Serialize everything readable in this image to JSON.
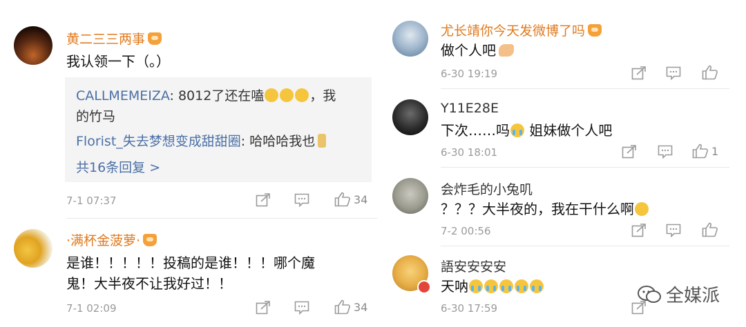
{
  "left": [
    {
      "username": "黄二三三两事",
      "text": "我认领一下（。）",
      "replies": [
        {
          "user": "CALLMEMEIZA",
          "line1": "8012了还在嗑",
          "line1_tail": "，我",
          "line2": "的竹马"
        },
        {
          "user": "Florist_失去梦想变成甜甜圈",
          "text": "哈哈哈我也"
        }
      ],
      "more_replies": "共16条回复 >",
      "time": "7-1 07:37",
      "likes": "34"
    },
    {
      "username": "·满杯金菠萝·",
      "text_line1": "是谁！！！！！投稿的是谁！！！哪个魔",
      "text_line2": "鬼！大半夜不让我好过！！",
      "time": "7-1 02:09",
      "likes": "34"
    }
  ],
  "right": [
    {
      "username": "尤长靖你今天发微博了吗",
      "text": "做个人吧",
      "time": "6-30 19:19",
      "likes": ""
    },
    {
      "username": "Y11E28E",
      "text_a": "下次……吗",
      "text_b": "姐妹做个人吧",
      "time": "6-30 18:01",
      "likes": "1"
    },
    {
      "username": "会炸毛的小兔叽",
      "text": "？？？大半夜的，我在干什么啊",
      "time": "7-2 00:56",
      "likes": ""
    },
    {
      "username": "語安安安安",
      "text": "天呐",
      "time": "6-30 17:59",
      "likes": ""
    }
  ],
  "watermark": "全媒派",
  "colors": {
    "vip_name": "#e07a1e",
    "link_blue": "#4a6fa6",
    "meta_gray": "#9a9a9a",
    "reply_bg": "#f4f4f4"
  }
}
